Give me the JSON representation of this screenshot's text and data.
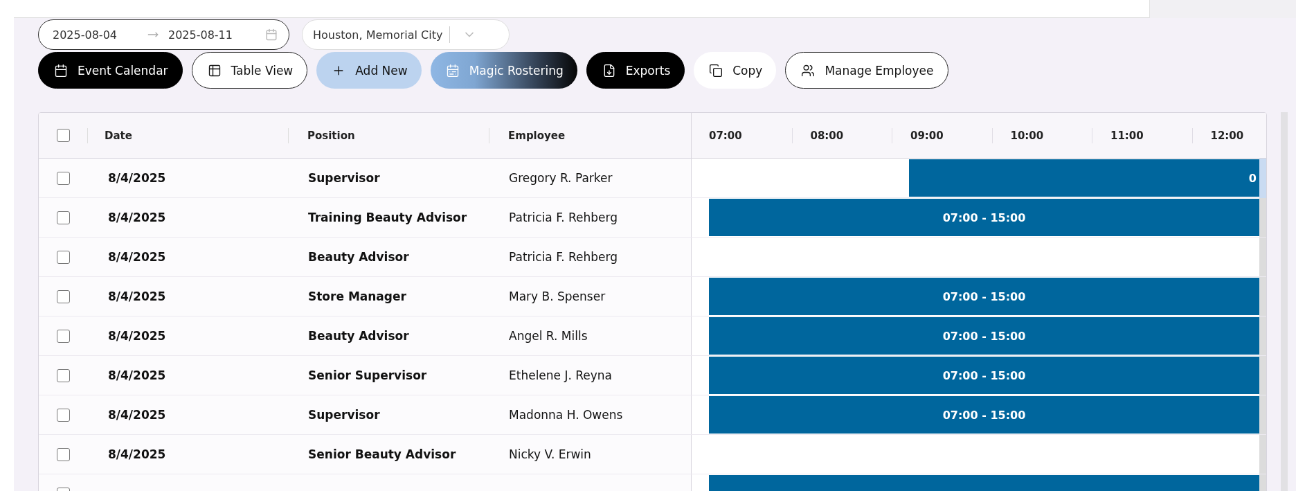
{
  "filters": {
    "date_from": "2025-08-04",
    "date_to": "2025-08-11",
    "location": "Houston, Memorial City"
  },
  "toolbar": [
    {
      "label": "Event Calendar",
      "kind": "dark"
    },
    {
      "label": "Table View",
      "kind": "outline"
    },
    {
      "label": "Add New",
      "kind": "soft"
    },
    {
      "label": "Magic Rostering",
      "kind": "gradient"
    },
    {
      "label": "Exports",
      "kind": "dark"
    },
    {
      "label": "Copy",
      "kind": "plain"
    },
    {
      "label": "Manage Employee",
      "kind": "outline"
    }
  ],
  "table": {
    "header_checked": false,
    "columns": [
      "Date",
      "Position",
      "Employee"
    ],
    "hours": [
      "07:00",
      "08:00",
      "09:00",
      "10:00",
      "11:00",
      "12:00"
    ],
    "rows": [
      {
        "checked": false,
        "date": "8/4/2025",
        "position": "Supervisor",
        "employee": "Gregory R. Parker",
        "shift": {
          "kind": "late",
          "label": "0"
        }
      },
      {
        "checked": false,
        "date": "8/4/2025",
        "position": "Training Beauty Advisor",
        "employee": "Patricia F. Rehberg",
        "shift": {
          "kind": "day",
          "label": "07:00 - 15:00"
        }
      },
      {
        "checked": false,
        "date": "8/4/2025",
        "position": "Beauty Advisor",
        "employee": "Patricia F. Rehberg"
      },
      {
        "checked": false,
        "date": "8/4/2025",
        "position": "Store Manager",
        "employee": "Mary B. Spenser",
        "shift": {
          "kind": "day",
          "label": "07:00 - 15:00"
        }
      },
      {
        "checked": false,
        "date": "8/4/2025",
        "position": "Beauty Advisor",
        "employee": "Angel R. Mills",
        "shift": {
          "kind": "day",
          "label": "07:00 - 15:00"
        }
      },
      {
        "checked": false,
        "date": "8/4/2025",
        "position": "Senior Supervisor",
        "employee": "Ethelene J. Reyna",
        "shift": {
          "kind": "day",
          "label": "07:00 - 15:00"
        }
      },
      {
        "checked": false,
        "date": "8/4/2025",
        "position": "Supervisor",
        "employee": "Madonna H. Owens",
        "shift": {
          "kind": "day",
          "label": "07:00 - 15:00"
        }
      },
      {
        "checked": false,
        "date": "8/4/2025",
        "position": "Senior Beauty Advisor",
        "employee": "Nicky V. Erwin"
      },
      {
        "checked": false,
        "shift": {
          "kind": "day"
        }
      }
    ]
  }
}
